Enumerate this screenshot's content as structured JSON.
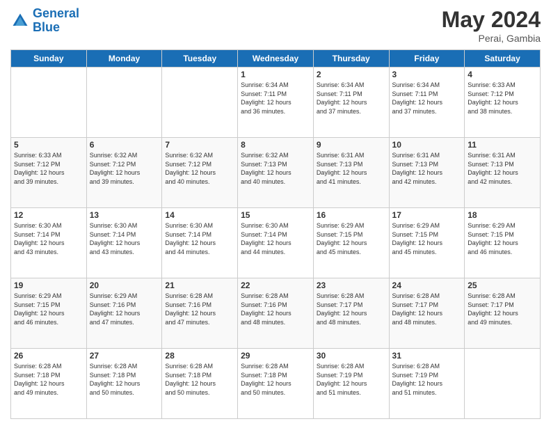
{
  "header": {
    "logo_line1": "General",
    "logo_line2": "Blue",
    "month_title": "May 2024",
    "location": "Perai, Gambia"
  },
  "weekdays": [
    "Sunday",
    "Monday",
    "Tuesday",
    "Wednesday",
    "Thursday",
    "Friday",
    "Saturday"
  ],
  "weeks": [
    [
      {
        "day": "",
        "info": ""
      },
      {
        "day": "",
        "info": ""
      },
      {
        "day": "",
        "info": ""
      },
      {
        "day": "1",
        "info": "Sunrise: 6:34 AM\nSunset: 7:11 PM\nDaylight: 12 hours\nand 36 minutes."
      },
      {
        "day": "2",
        "info": "Sunrise: 6:34 AM\nSunset: 7:11 PM\nDaylight: 12 hours\nand 37 minutes."
      },
      {
        "day": "3",
        "info": "Sunrise: 6:34 AM\nSunset: 7:11 PM\nDaylight: 12 hours\nand 37 minutes."
      },
      {
        "day": "4",
        "info": "Sunrise: 6:33 AM\nSunset: 7:12 PM\nDaylight: 12 hours\nand 38 minutes."
      }
    ],
    [
      {
        "day": "5",
        "info": "Sunrise: 6:33 AM\nSunset: 7:12 PM\nDaylight: 12 hours\nand 39 minutes."
      },
      {
        "day": "6",
        "info": "Sunrise: 6:32 AM\nSunset: 7:12 PM\nDaylight: 12 hours\nand 39 minutes."
      },
      {
        "day": "7",
        "info": "Sunrise: 6:32 AM\nSunset: 7:12 PM\nDaylight: 12 hours\nand 40 minutes."
      },
      {
        "day": "8",
        "info": "Sunrise: 6:32 AM\nSunset: 7:13 PM\nDaylight: 12 hours\nand 40 minutes."
      },
      {
        "day": "9",
        "info": "Sunrise: 6:31 AM\nSunset: 7:13 PM\nDaylight: 12 hours\nand 41 minutes."
      },
      {
        "day": "10",
        "info": "Sunrise: 6:31 AM\nSunset: 7:13 PM\nDaylight: 12 hours\nand 42 minutes."
      },
      {
        "day": "11",
        "info": "Sunrise: 6:31 AM\nSunset: 7:13 PM\nDaylight: 12 hours\nand 42 minutes."
      }
    ],
    [
      {
        "day": "12",
        "info": "Sunrise: 6:30 AM\nSunset: 7:14 PM\nDaylight: 12 hours\nand 43 minutes."
      },
      {
        "day": "13",
        "info": "Sunrise: 6:30 AM\nSunset: 7:14 PM\nDaylight: 12 hours\nand 43 minutes."
      },
      {
        "day": "14",
        "info": "Sunrise: 6:30 AM\nSunset: 7:14 PM\nDaylight: 12 hours\nand 44 minutes."
      },
      {
        "day": "15",
        "info": "Sunrise: 6:30 AM\nSunset: 7:14 PM\nDaylight: 12 hours\nand 44 minutes."
      },
      {
        "day": "16",
        "info": "Sunrise: 6:29 AM\nSunset: 7:15 PM\nDaylight: 12 hours\nand 45 minutes."
      },
      {
        "day": "17",
        "info": "Sunrise: 6:29 AM\nSunset: 7:15 PM\nDaylight: 12 hours\nand 45 minutes."
      },
      {
        "day": "18",
        "info": "Sunrise: 6:29 AM\nSunset: 7:15 PM\nDaylight: 12 hours\nand 46 minutes."
      }
    ],
    [
      {
        "day": "19",
        "info": "Sunrise: 6:29 AM\nSunset: 7:15 PM\nDaylight: 12 hours\nand 46 minutes."
      },
      {
        "day": "20",
        "info": "Sunrise: 6:29 AM\nSunset: 7:16 PM\nDaylight: 12 hours\nand 47 minutes."
      },
      {
        "day": "21",
        "info": "Sunrise: 6:28 AM\nSunset: 7:16 PM\nDaylight: 12 hours\nand 47 minutes."
      },
      {
        "day": "22",
        "info": "Sunrise: 6:28 AM\nSunset: 7:16 PM\nDaylight: 12 hours\nand 48 minutes."
      },
      {
        "day": "23",
        "info": "Sunrise: 6:28 AM\nSunset: 7:17 PM\nDaylight: 12 hours\nand 48 minutes."
      },
      {
        "day": "24",
        "info": "Sunrise: 6:28 AM\nSunset: 7:17 PM\nDaylight: 12 hours\nand 48 minutes."
      },
      {
        "day": "25",
        "info": "Sunrise: 6:28 AM\nSunset: 7:17 PM\nDaylight: 12 hours\nand 49 minutes."
      }
    ],
    [
      {
        "day": "26",
        "info": "Sunrise: 6:28 AM\nSunset: 7:18 PM\nDaylight: 12 hours\nand 49 minutes."
      },
      {
        "day": "27",
        "info": "Sunrise: 6:28 AM\nSunset: 7:18 PM\nDaylight: 12 hours\nand 50 minutes."
      },
      {
        "day": "28",
        "info": "Sunrise: 6:28 AM\nSunset: 7:18 PM\nDaylight: 12 hours\nand 50 minutes."
      },
      {
        "day": "29",
        "info": "Sunrise: 6:28 AM\nSunset: 7:18 PM\nDaylight: 12 hours\nand 50 minutes."
      },
      {
        "day": "30",
        "info": "Sunrise: 6:28 AM\nSunset: 7:19 PM\nDaylight: 12 hours\nand 51 minutes."
      },
      {
        "day": "31",
        "info": "Sunrise: 6:28 AM\nSunset: 7:19 PM\nDaylight: 12 hours\nand 51 minutes."
      },
      {
        "day": "",
        "info": ""
      }
    ]
  ]
}
